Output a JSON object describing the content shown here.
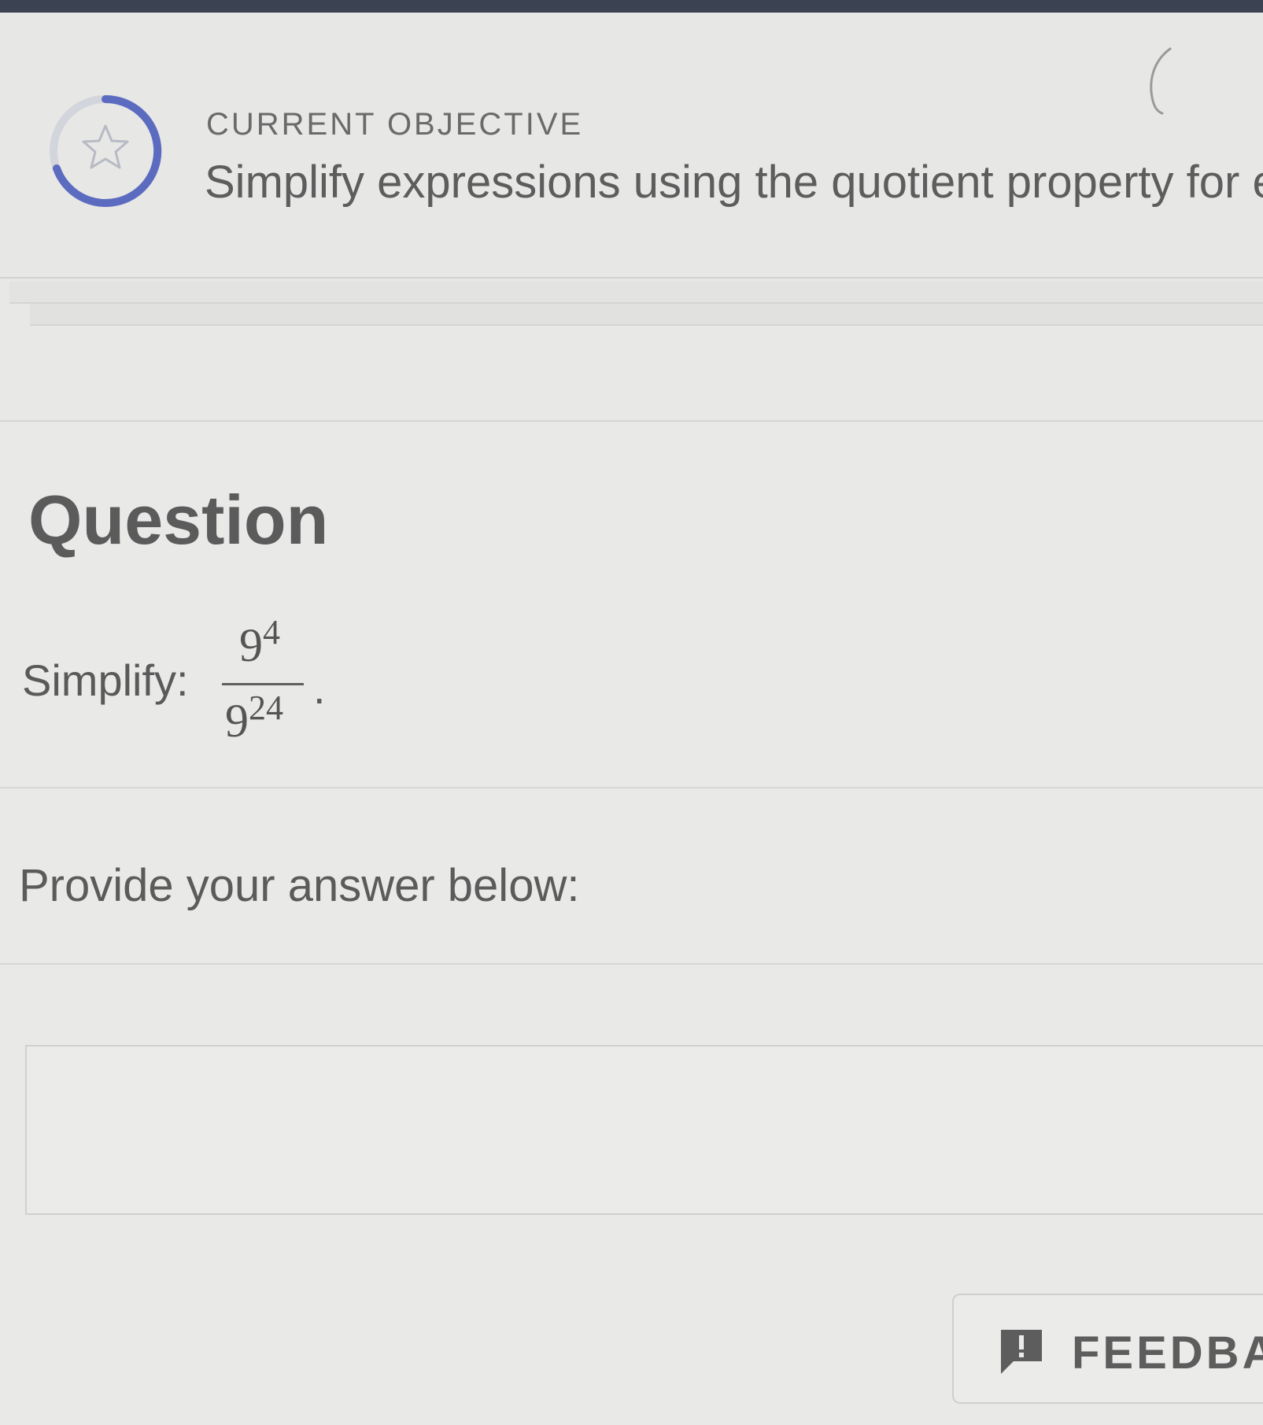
{
  "objective": {
    "label": "CURRENT OBJECTIVE",
    "title": "Simplify expressions using the quotient property for exponents"
  },
  "question": {
    "heading": "Question",
    "prompt": "Simplify:",
    "numerator_base": "9",
    "numerator_exponent": "4",
    "denominator_base": "9",
    "denominator_exponent": "24",
    "trailing": "."
  },
  "answer": {
    "prompt": "Provide your answer below:",
    "value": ""
  },
  "feedback": {
    "label": "FEEDBACK"
  },
  "icons": {
    "progress": "star-progress-ring-icon",
    "collapse": "collapse-arc-icon",
    "feedback": "exclamation-speech-bubble-icon"
  },
  "colors": {
    "accent": "#5b6bbf",
    "top_bar": "#3b4352",
    "text": "#5c5c5c",
    "background": "#e8e8e7"
  }
}
